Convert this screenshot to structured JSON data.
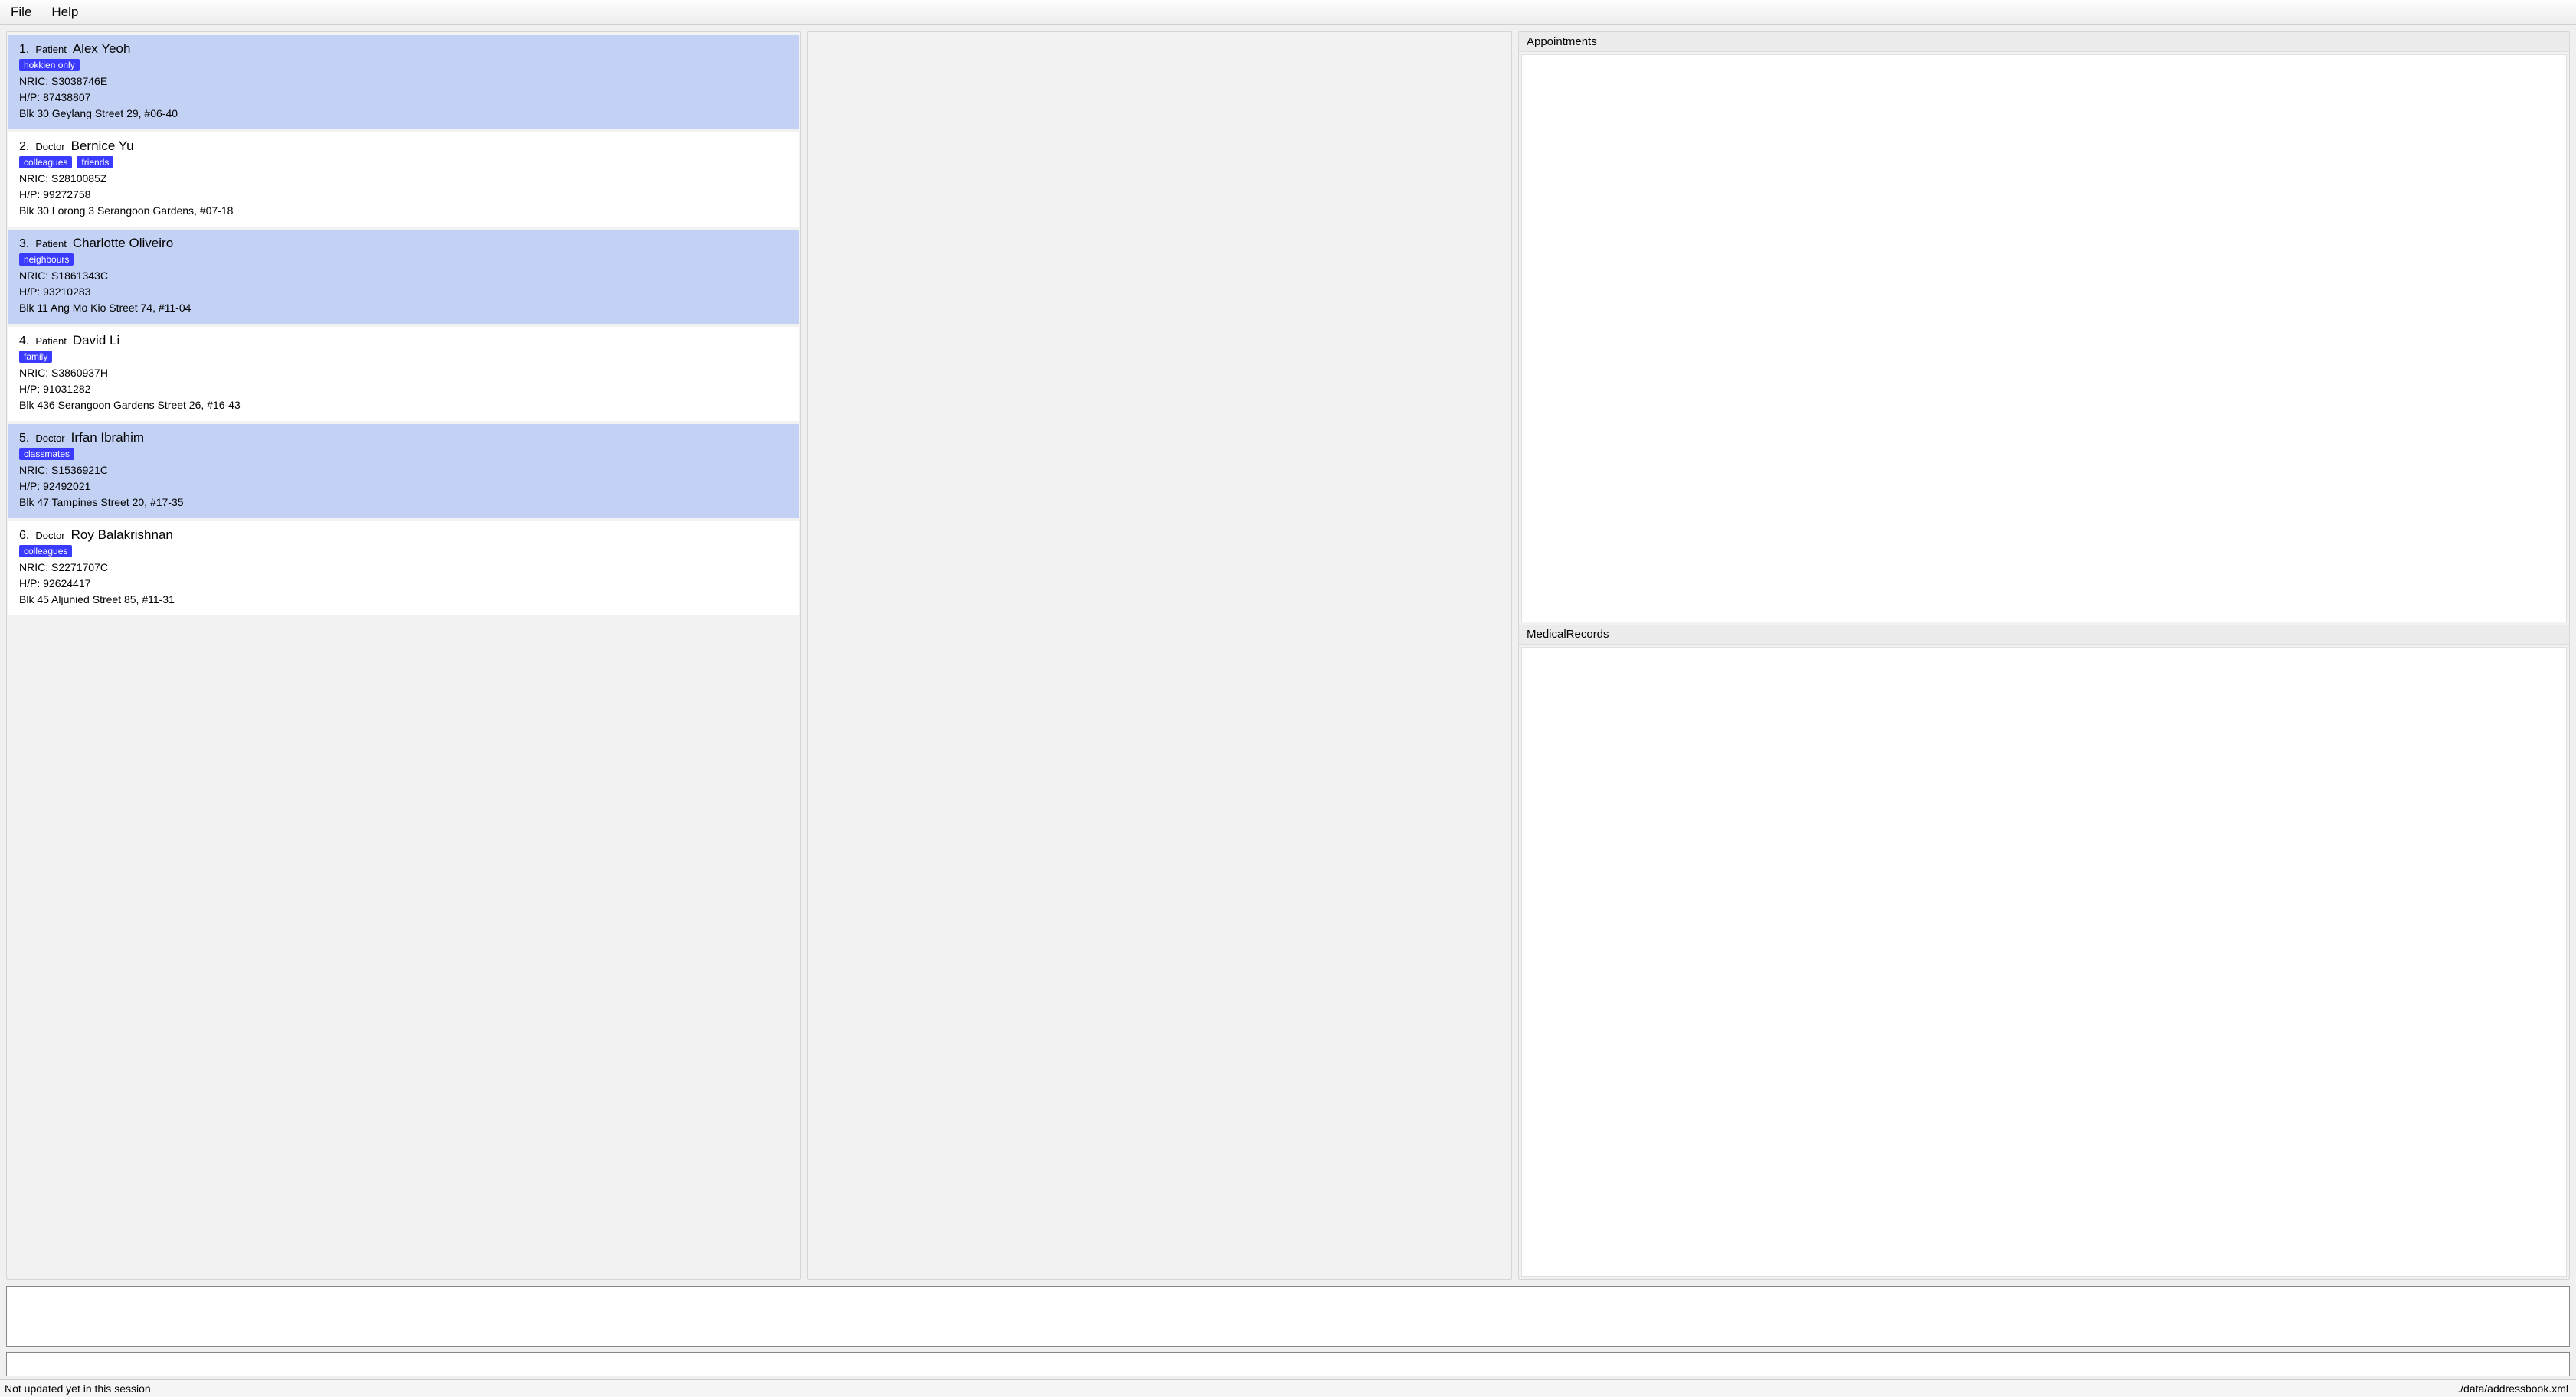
{
  "menubar": {
    "file": "File",
    "help": "Help"
  },
  "persons": [
    {
      "index": "1.",
      "role": "Patient",
      "name": "Alex Yeoh",
      "tags": [
        "hokkien only"
      ],
      "nric": "NRIC: S3038746E",
      "hp": "H/P: 87438807",
      "address": "Blk 30 Geylang Street 29, #06-40",
      "alt": true
    },
    {
      "index": "2.",
      "role": "Doctor",
      "name": "Bernice Yu",
      "tags": [
        "colleagues",
        "friends"
      ],
      "nric": "NRIC: S2810085Z",
      "hp": "H/P: 99272758",
      "address": "Blk 30 Lorong 3 Serangoon Gardens, #07-18",
      "alt": false
    },
    {
      "index": "3.",
      "role": "Patient",
      "name": "Charlotte Oliveiro",
      "tags": [
        "neighbours"
      ],
      "nric": "NRIC: S1861343C",
      "hp": "H/P: 93210283",
      "address": "Blk 11 Ang Mo Kio Street 74, #11-04",
      "alt": true
    },
    {
      "index": "4.",
      "role": "Patient",
      "name": "David Li",
      "tags": [
        "family"
      ],
      "nric": "NRIC: S3860937H",
      "hp": "H/P: 91031282",
      "address": "Blk 436 Serangoon Gardens Street 26, #16-43",
      "alt": false
    },
    {
      "index": "5.",
      "role": "Doctor",
      "name": "Irfan Ibrahim",
      "tags": [
        "classmates"
      ],
      "nric": "NRIC: S1536921C",
      "hp": "H/P: 92492021",
      "address": "Blk 47 Tampines Street 20, #17-35",
      "alt": true
    },
    {
      "index": "6.",
      "role": "Doctor",
      "name": "Roy Balakrishnan",
      "tags": [
        "colleagues"
      ],
      "nric": "NRIC: S2271707C",
      "hp": "H/P: 92624417",
      "address": "Blk 45 Aljunied Street 85, #11-31",
      "alt": false
    }
  ],
  "right": {
    "appointments_header": "Appointments",
    "medicalrecords_header": "MedicalRecords"
  },
  "command_value": "",
  "status": {
    "left": "Not updated yet in this session",
    "right": "./data/addressbook.xml"
  }
}
